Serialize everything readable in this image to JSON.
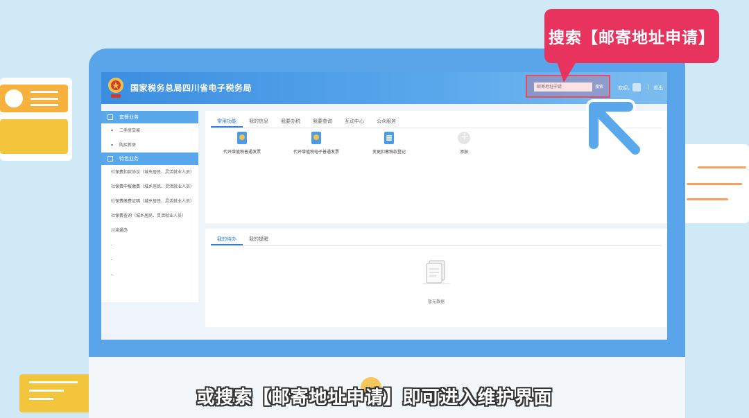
{
  "header": {
    "title": "国家税务总局四川省电子税务局",
    "search_placeholder": "邮寄地址申请",
    "search_button": "搜索",
    "welcome": "欢迎，",
    "separator": "|",
    "logout": "退出"
  },
  "sidebar": {
    "sections": [
      {
        "label": "套餐业务",
        "items": [
          "二手房交易",
          "购买新房"
        ]
      },
      {
        "label": "特色业务",
        "items": [
          "社保费扣款协议（城乡居民、灵活就业人员）",
          "社保费申报缴费（城乡居民、灵活就业人员）",
          "社保费缴费证明（城乡居民、灵活就业人员）",
          "社保费查询（城乡居民、灵活就业人员）",
          "川渝通办",
          "-",
          "-",
          "-"
        ]
      }
    ]
  },
  "panel1": {
    "tabs": [
      "常用功能",
      "我的信息",
      "我要办税",
      "我要查询",
      "互动中心",
      "公众服务"
    ],
    "functions": [
      {
        "label": "代开增值税普通发票",
        "icon": "shield-doc-icon"
      },
      {
        "label": "代开增值税电子普通发票",
        "icon": "shield-doc-icon"
      },
      {
        "label": "变更扣缴税款登记",
        "icon": "document-icon"
      },
      {
        "label": "添加",
        "icon": "add-icon"
      }
    ]
  },
  "panel2": {
    "tabs": [
      "我的待办",
      "我的提醒"
    ],
    "empty_text": "暂无数据"
  },
  "callout": {
    "text": "搜索【邮寄地址申请】"
  },
  "subtitle": "或搜索【邮寄地址申请】即可进入维护界面",
  "colors": {
    "accent": "#e8335e",
    "primary": "#5aa8ec",
    "tab_active": "#2f7fd6"
  }
}
